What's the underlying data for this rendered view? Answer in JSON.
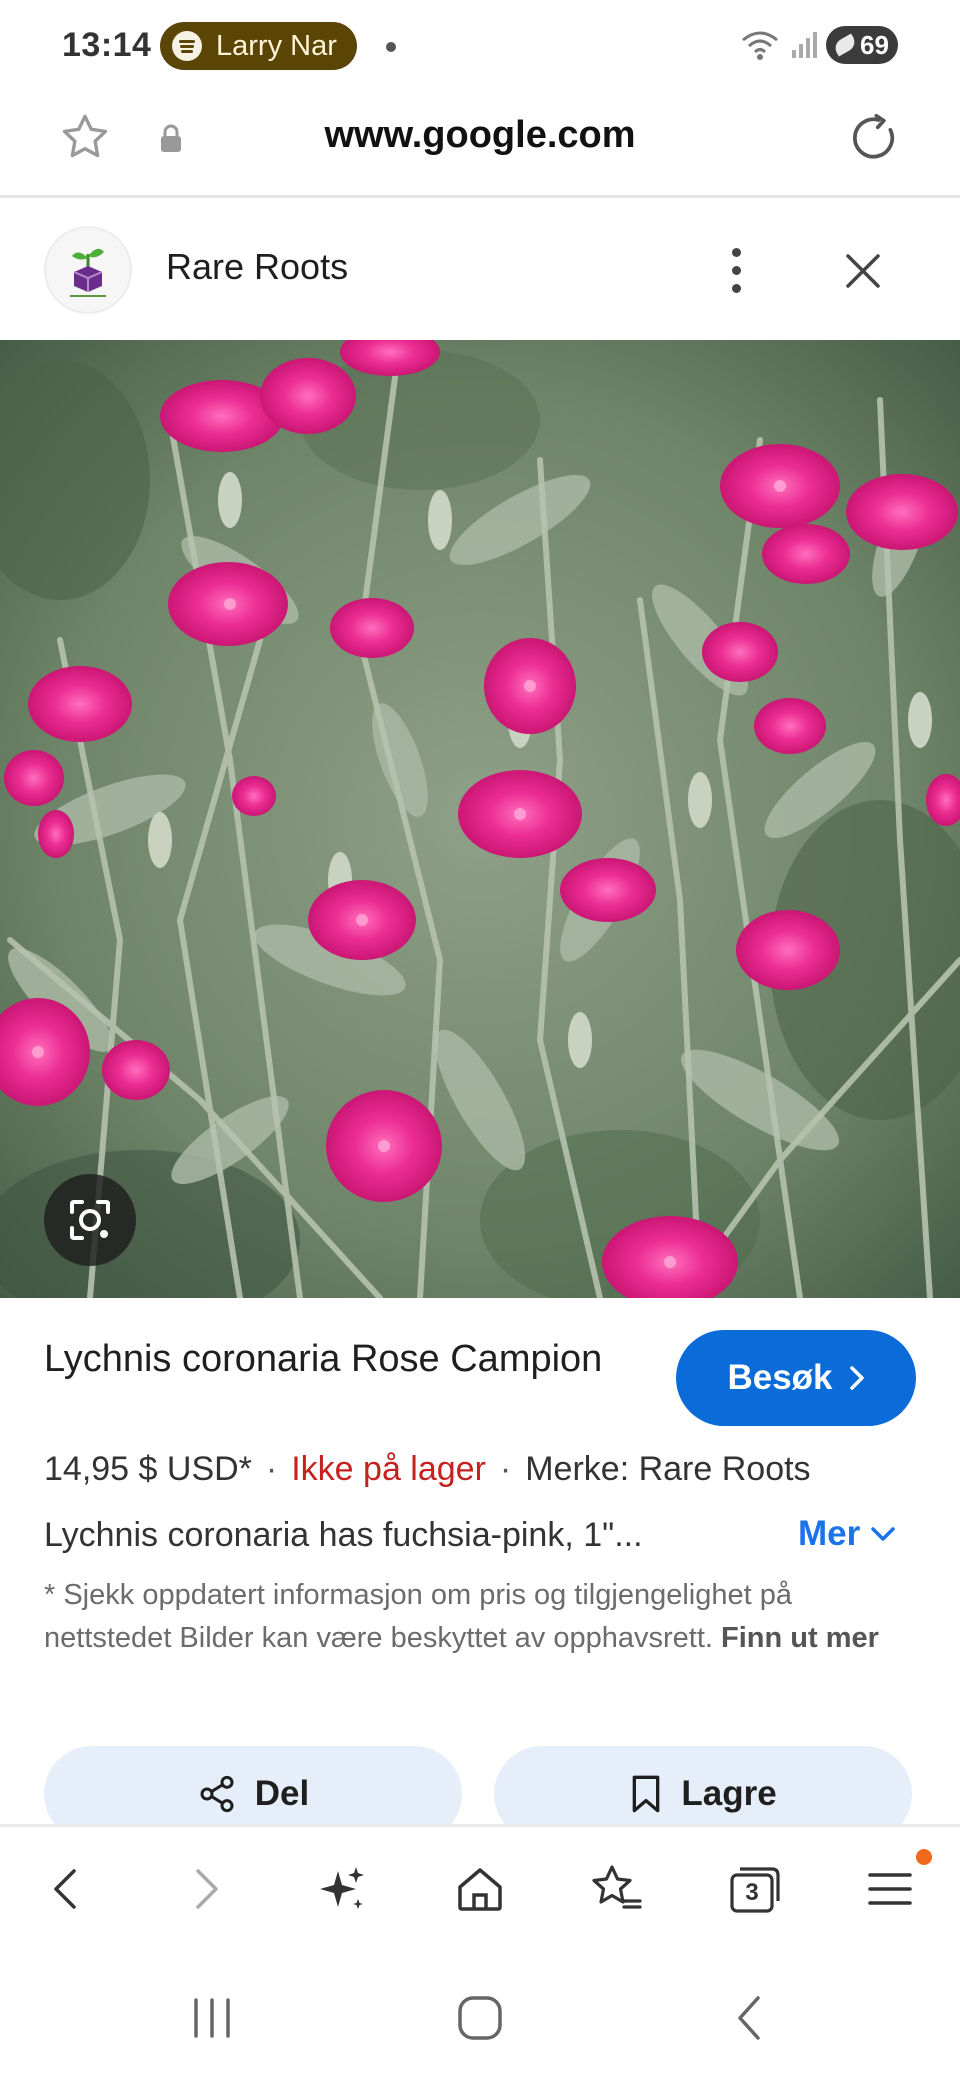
{
  "status_bar": {
    "time": "13:14",
    "media_text": "Larry Nar",
    "battery_level": "69"
  },
  "browser": {
    "url": "www.google.com"
  },
  "site": {
    "name": "Rare Roots"
  },
  "product": {
    "title": "Lychnis coronaria Rose Campion",
    "visit_label": "Besøk",
    "price": "14,95 $ USD*",
    "separator": "·",
    "stock": "Ikke på lager",
    "brand": "Merke: Rare Roots",
    "description": "Lychnis coronaria has fuchsia-pink, 1\"...",
    "more_label": "Mer",
    "disclaimer": "* Sjekk oppdatert informasjon om pris og tilgjengelighet på nettstedet Bilder kan være beskyttet av opphavsrett.",
    "disclaimer_link": "Finn ut mer"
  },
  "actions": {
    "share_label": "Del",
    "save_label": "Lagre"
  },
  "browser_nav": {
    "tab_count": "3"
  },
  "colors": {
    "accent": "#0b6bd8",
    "stock_red": "#c5221f",
    "flower_pink": "#e8288a",
    "media_pill": "#5a4507"
  },
  "icons": [
    "spotify-icon",
    "wifi-icon",
    "signal-icon",
    "battery-icon",
    "bookmark-star-icon",
    "lock-icon",
    "reload-icon",
    "more-vert-icon",
    "close-icon",
    "lens-icon",
    "chevron-right-icon",
    "chevron-down-icon",
    "share-icon",
    "bookmark-icon",
    "back-icon",
    "forward-icon",
    "sparkle-icon",
    "home-icon",
    "favorites-icon",
    "tabs-icon",
    "menu-icon"
  ]
}
